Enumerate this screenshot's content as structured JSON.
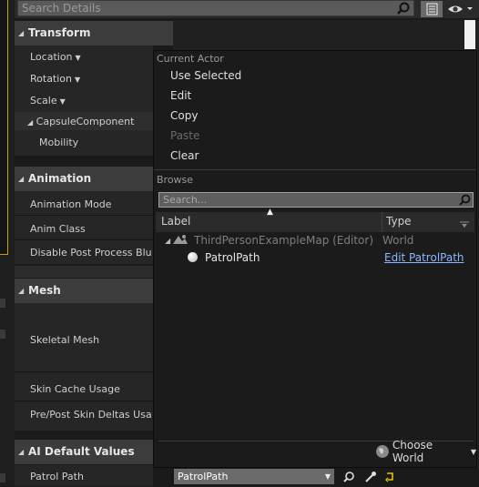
{
  "search": {
    "placeholder": "Search Details"
  },
  "categories": {
    "transform": "Transform",
    "animation": "Animation",
    "mesh": "Mesh",
    "ai_default_values": "AI Default Values"
  },
  "properties": {
    "location": "Location",
    "rotation": "Rotation",
    "scale": "Scale",
    "capsule_component": "CapsuleComponent",
    "mobility": "Mobility",
    "animation_mode": "Animation Mode",
    "anim_class": "Anim Class",
    "disable_post_process": "Disable Post Process Blueprint",
    "skeletal_mesh": "Skeletal Mesh",
    "skin_cache_usage": "Skin Cache Usage",
    "pre_post_skin_deltas": "Pre/Post Skin Deltas Usage",
    "patrol_path": "Patrol Path"
  },
  "patrol_path_value": "PatrolPath",
  "popup": {
    "current_actor_header": "Current Actor",
    "use_selected": "Use Selected",
    "edit": "Edit",
    "copy": "Copy",
    "paste": "Paste",
    "clear": "Clear",
    "browse_header": "Browse",
    "search_placeholder": "Search...",
    "col_label": "Label",
    "col_type": "Type",
    "tree": {
      "map_label": "ThirdPersonExampleMap (Editor)",
      "map_type": "World",
      "actor_label": "PatrolPath",
      "actor_action": "Edit PatrolPath"
    },
    "choose_world": "Choose World"
  },
  "colors": {
    "link": "#8ab6ff",
    "selection_outline": "#c8a000",
    "patrol_icon": "#e6c200"
  }
}
